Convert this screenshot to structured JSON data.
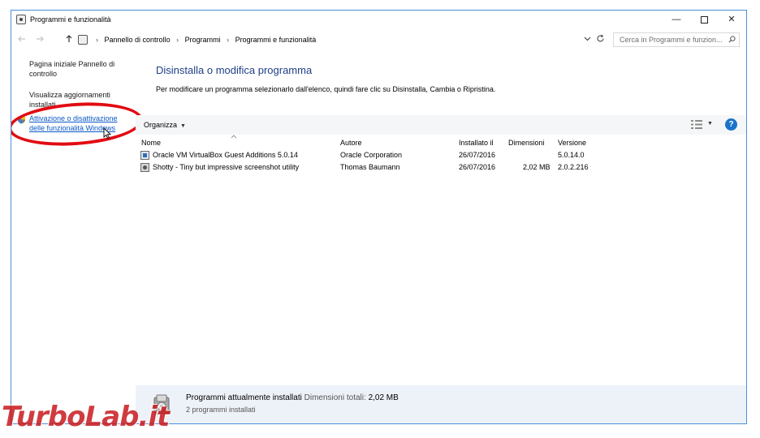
{
  "window": {
    "title": "Programmi e funzionalità",
    "controls": {
      "minimize": "—",
      "close": "✕"
    }
  },
  "address_bar": {
    "breadcrumbs": [
      "Pannello di controllo",
      "Programmi",
      "Programmi e funzionalità"
    ],
    "search_placeholder": "Cerca in Programmi e funzion..."
  },
  "sidebar": {
    "links": [
      {
        "label": "Pagina iniziale Pannello di controllo"
      },
      {
        "label": "Visualizza aggiornamenti installati"
      },
      {
        "label": "Attivazione o disattivazione delle funzionalità Windows"
      }
    ]
  },
  "main": {
    "heading": "Disinstalla o modifica programma",
    "instructions": "Per modificare un programma selezionarlo dall'elenco, quindi fare clic su Disinstalla, Cambia o Ripristina.",
    "toolbar": {
      "organize_label": "Organizza",
      "help_label": "?"
    },
    "columns": [
      "Nome",
      "Autore",
      "Installato il",
      "Dimensioni",
      "Versione"
    ],
    "rows": [
      {
        "name": "Oracle VM VirtualBox Guest Additions 5.0.14",
        "publisher": "Oracle Corporation",
        "installed_on": "26/07/2016",
        "size": "",
        "version": "5.0.14.0",
        "icon": "virtualbox-icon"
      },
      {
        "name": "Shotty - Tiny but impressive screenshot utility",
        "publisher": "Thomas Baumann",
        "installed_on": "26/07/2016",
        "size": "2,02 MB",
        "version": "2.0.2.216",
        "icon": "shotty-icon"
      }
    ]
  },
  "details": {
    "title": "Programmi attualmente installati",
    "total_size_label": "Dimensioni totali:",
    "total_size": "2,02 MB",
    "count_text": "2 programmi installati"
  },
  "watermark": {
    "text": "TurboLab.it"
  },
  "colors": {
    "heading": "#1e3f85",
    "link": "#0b58c7",
    "annotation": "#e20b12",
    "details_bg": "#edf2f9",
    "window_border": "#4a90d9"
  }
}
